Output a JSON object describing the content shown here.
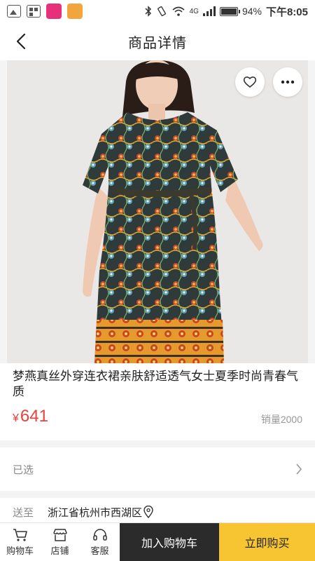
{
  "status_bar": {
    "app_icons": [
      "image-icon",
      "qr-grid-icon",
      "sale-app-icon",
      "year-app-icon"
    ],
    "battery_text": "94%",
    "time": "下午8:05",
    "network": "4G"
  },
  "nav": {
    "title": "商品详情"
  },
  "product": {
    "title": "梦燕真丝外穿连衣裙亲肤舒适透气女士夏季时尚青春气质",
    "currency": "¥",
    "price": "641",
    "sales": "销量2000"
  },
  "options": {
    "selected_label": "已选"
  },
  "shipping": {
    "label": "送至",
    "address": "浙江省杭州市西湖区"
  },
  "bottom_bar": {
    "cart_label": "购物车",
    "shop_label": "店铺",
    "service_label": "客服",
    "add_to_cart": "加入购物车",
    "buy_now": "立即购买"
  },
  "colors": {
    "price": "#e5423b",
    "buy_button": "#f6c531",
    "cart_button": "#2b2b2b"
  }
}
